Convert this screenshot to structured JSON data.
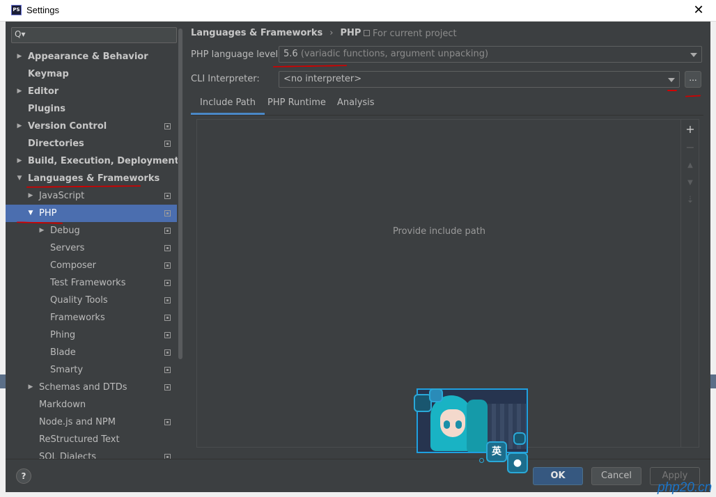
{
  "window": {
    "app_icon_text": "PS",
    "title": "Settings",
    "close_glyph": "✕"
  },
  "search": {
    "icon": "Q▾",
    "value": ""
  },
  "tree": [
    {
      "label": "Appearance & Behavior",
      "bold": true,
      "arrow": "▶",
      "level": 0,
      "project_icon": false
    },
    {
      "label": "Keymap",
      "bold": true,
      "arrow": "",
      "level": 0,
      "project_icon": false
    },
    {
      "label": "Editor",
      "bold": true,
      "arrow": "▶",
      "level": 0,
      "project_icon": false
    },
    {
      "label": "Plugins",
      "bold": true,
      "arrow": "",
      "level": 0,
      "project_icon": false
    },
    {
      "label": "Version Control",
      "bold": true,
      "arrow": "▶",
      "level": 0,
      "project_icon": true
    },
    {
      "label": "Directories",
      "bold": true,
      "arrow": "",
      "level": 0,
      "project_icon": true
    },
    {
      "label": "Build, Execution, Deployment",
      "bold": true,
      "arrow": "▶",
      "level": 0,
      "project_icon": false
    },
    {
      "label": "Languages & Frameworks",
      "bold": true,
      "arrow": "▼",
      "level": 0,
      "project_icon": false
    },
    {
      "label": "JavaScript",
      "bold": false,
      "arrow": "▶",
      "level": 1,
      "project_icon": true
    },
    {
      "label": "PHP",
      "bold": false,
      "arrow": "▼",
      "level": 1,
      "project_icon": true,
      "selected": true
    },
    {
      "label": "Debug",
      "bold": false,
      "arrow": "▶",
      "level": 2,
      "project_icon": true
    },
    {
      "label": "Servers",
      "bold": false,
      "arrow": "",
      "level": 2,
      "project_icon": true
    },
    {
      "label": "Composer",
      "bold": false,
      "arrow": "",
      "level": 2,
      "project_icon": true
    },
    {
      "label": "Test Frameworks",
      "bold": false,
      "arrow": "",
      "level": 2,
      "project_icon": true
    },
    {
      "label": "Quality Tools",
      "bold": false,
      "arrow": "",
      "level": 2,
      "project_icon": true
    },
    {
      "label": "Frameworks",
      "bold": false,
      "arrow": "",
      "level": 2,
      "project_icon": true
    },
    {
      "label": "Phing",
      "bold": false,
      "arrow": "",
      "level": 2,
      "project_icon": true
    },
    {
      "label": "Blade",
      "bold": false,
      "arrow": "",
      "level": 2,
      "project_icon": true
    },
    {
      "label": "Smarty",
      "bold": false,
      "arrow": "",
      "level": 2,
      "project_icon": true
    },
    {
      "label": "Schemas and DTDs",
      "bold": false,
      "arrow": "▶",
      "level": 1,
      "project_icon": true
    },
    {
      "label": "Markdown",
      "bold": false,
      "arrow": "",
      "level": 1,
      "project_icon": false
    },
    {
      "label": "Node.js and NPM",
      "bold": false,
      "arrow": "",
      "level": 1,
      "project_icon": true
    },
    {
      "label": "ReStructured Text",
      "bold": false,
      "arrow": "",
      "level": 1,
      "project_icon": false
    },
    {
      "label": "SQL Dialects",
      "bold": false,
      "arrow": "",
      "level": 1,
      "project_icon": true
    }
  ],
  "breadcrumb": {
    "parent": "Languages & Frameworks",
    "separator": "›",
    "current": "PHP",
    "scope": "For current project"
  },
  "php_level": {
    "label": "PHP language level:",
    "version": "5.6",
    "description": "(variadic functions, argument unpacking)"
  },
  "cli": {
    "label": "CLI Interpreter:",
    "value": "<no interpreter>",
    "browse_label": "..."
  },
  "tabs": [
    {
      "label": "Include Path",
      "active": true
    },
    {
      "label": "PHP Runtime",
      "active": false
    },
    {
      "label": "Analysis",
      "active": false
    }
  ],
  "include_path": {
    "empty_text": "Provide include path",
    "tools": [
      {
        "icon": "add-icon",
        "glyph": "+",
        "enabled": true
      },
      {
        "icon": "remove-icon",
        "glyph": "−",
        "enabled": false
      },
      {
        "icon": "move-up-icon",
        "glyph": "▲",
        "enabled": false
      },
      {
        "icon": "move-down-icon",
        "glyph": "▼",
        "enabled": false
      },
      {
        "icon": "sort-icon",
        "glyph": "⇣",
        "enabled": false
      }
    ]
  },
  "footer": {
    "help": "?",
    "ok": "OK",
    "cancel": "Cancel",
    "apply": "Apply"
  },
  "mascot": {
    "badge_text": "英"
  },
  "watermark": "php20.cn",
  "colors": {
    "background": "#3c3f41",
    "selection": "#4b6eaf",
    "accent_tab": "#4a88c7",
    "ok_button": "#365880",
    "annotation_red": "#d10000"
  }
}
